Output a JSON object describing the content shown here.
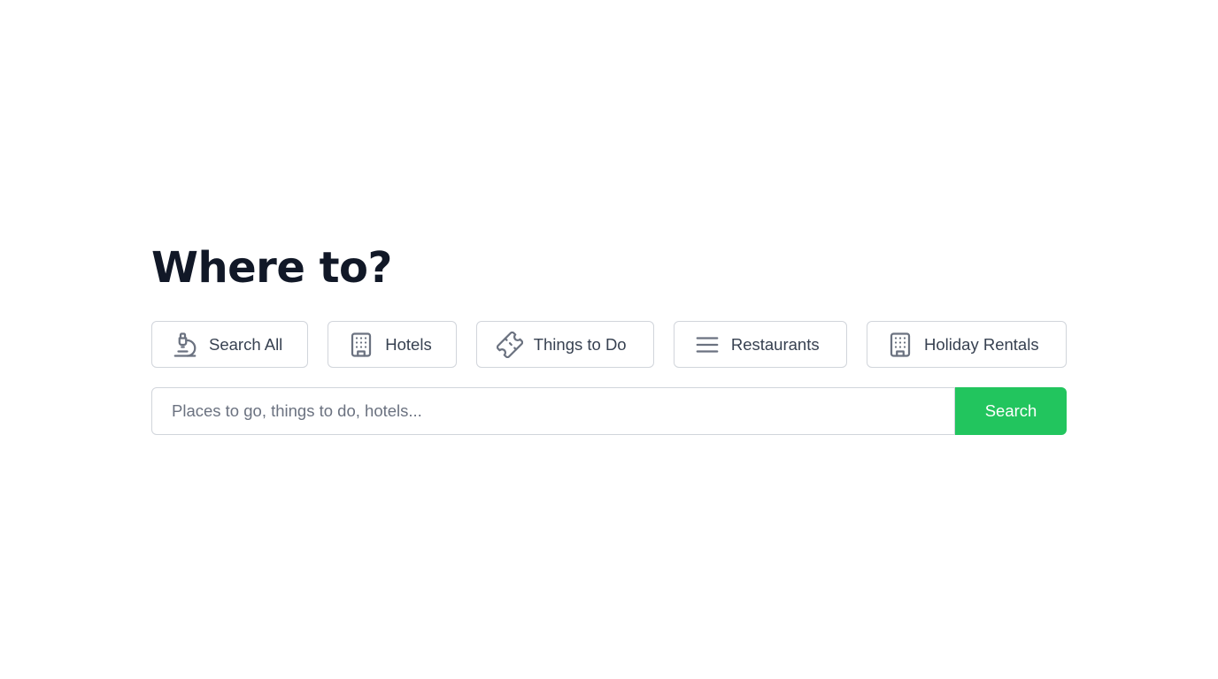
{
  "heading": "Where to?",
  "categories": [
    {
      "label": "Search All",
      "icon": "microscope-icon"
    },
    {
      "label": "Hotels",
      "icon": "building-icon"
    },
    {
      "label": "Things to Do",
      "icon": "ticket-icon"
    },
    {
      "label": "Restaurants",
      "icon": "menu-icon"
    },
    {
      "label": "Holiday Rentals",
      "icon": "building-icon"
    }
  ],
  "search": {
    "placeholder": "Places to go, things to do, hotels...",
    "value": "",
    "button_label": "Search"
  },
  "colors": {
    "accent": "#22c55e",
    "heading": "#111827",
    "border": "#d1d5db",
    "icon": "#6b7280",
    "label": "#374151"
  }
}
